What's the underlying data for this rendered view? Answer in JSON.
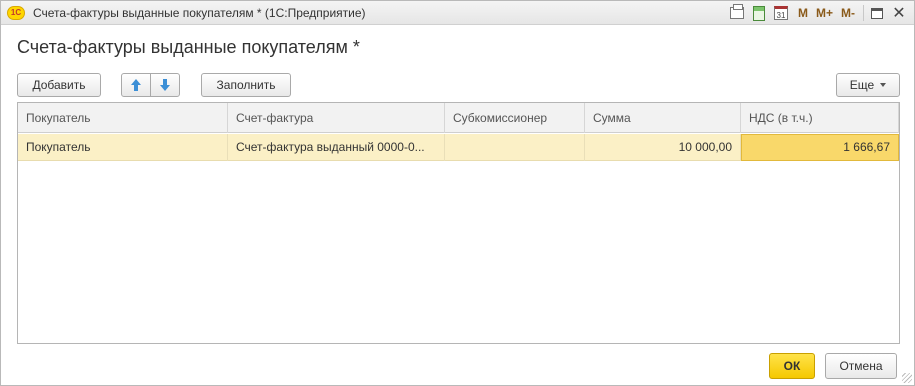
{
  "window": {
    "title": "Счета-фактуры выданные покупателям * (1С:Предприятие)",
    "logo": "1С"
  },
  "titlebar_icons": {
    "m": "M",
    "m_plus": "M+",
    "m_minus": "M-",
    "calendar_day": "31"
  },
  "form": {
    "title": "Счета-фактуры выданные покупателям *"
  },
  "toolbar": {
    "add_label": "Добавить",
    "fill_label": "Заполнить",
    "more_label": "Еще"
  },
  "table": {
    "columns": [
      "Покупатель",
      "Счет-фактура",
      "Субкомиссионер",
      "Сумма",
      "НДС (в т.ч.)"
    ],
    "rows": [
      {
        "buyer": "Покупатель",
        "invoice": "Счет-фактура выданный 0000-0...",
        "subcommissioner": "",
        "amount": "10 000,00",
        "vat": "1 666,67"
      }
    ]
  },
  "footer": {
    "ok_label": "ОК",
    "cancel_label": "Отмена"
  },
  "colors": {
    "selected_row": "#fbf0c6",
    "active_cell": "#f9d86a",
    "ok_button": "#f5c800",
    "arrow_icon": "#3c8fd6"
  }
}
